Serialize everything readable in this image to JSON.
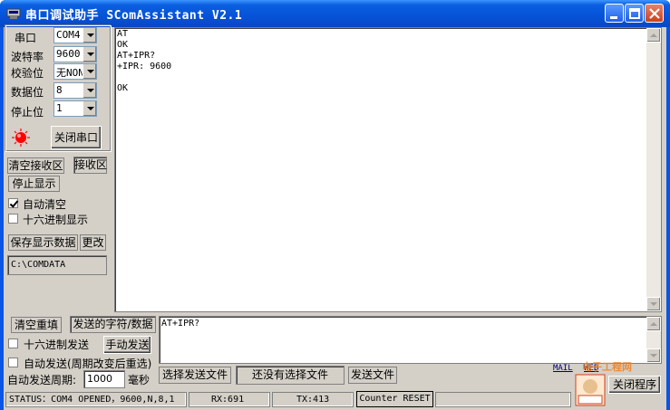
{
  "window": {
    "title": "串口调试助手  SComAssistant V2.1"
  },
  "port_settings": {
    "port_label": "串口",
    "port_value": "COM4",
    "baud_label": "波特率",
    "baud_value": "9600",
    "parity_label": "校验位",
    "parity_value": "无NONE",
    "databits_label": "数据位",
    "databits_value": "8",
    "stopbits_label": "停止位",
    "stopbits_value": "1",
    "close_port_label": "关闭串口"
  },
  "receive_panel": {
    "clear_receive_label": "清空接收区",
    "receive_area_label": "接收区",
    "stop_display_label": "停止显示",
    "auto_clear_label": "自动清空",
    "auto_clear_checked": true,
    "hex_display_label": "十六进制显示",
    "hex_display_checked": false,
    "save_display_label": "保存显示数据",
    "change_label": "更改",
    "save_path": "C:\\COMDATA"
  },
  "receive_output": "AT\nOK\nAT+IPR?\n+IPR: 9600\n\nOK",
  "send_panel": {
    "clear_resend_label": "清空重填",
    "send_string_label": "发送的字符/数据",
    "hex_send_label": "十六进制发送",
    "hex_send_checked": false,
    "manual_send_label": "手动发送",
    "auto_send_label": "自动发送(周期改变后重选)",
    "auto_send_checked": false,
    "period_label": "自动发送周期:",
    "period_value": "1000",
    "period_unit": "毫秒",
    "send_text": "AT+IPR?",
    "choose_file_label": "选择发送文件",
    "no_file_label": "还没有选择文件",
    "send_file_label": "发送文件",
    "close_program_label": "关闭程序",
    "mail_label": "MAIL",
    "web_label": "WEB"
  },
  "status_bar": {
    "status": "STATUS：COM4 OPENED，9600,N,8,1",
    "rx": "RX:691",
    "tx": "TX:413",
    "counter_reset": "Counter RESET"
  },
  "watermark": "电子工程网",
  "colors": {
    "title_bar": "#0653d8",
    "dialog_bg": "#d4d0c8",
    "led": "#ff0000"
  }
}
